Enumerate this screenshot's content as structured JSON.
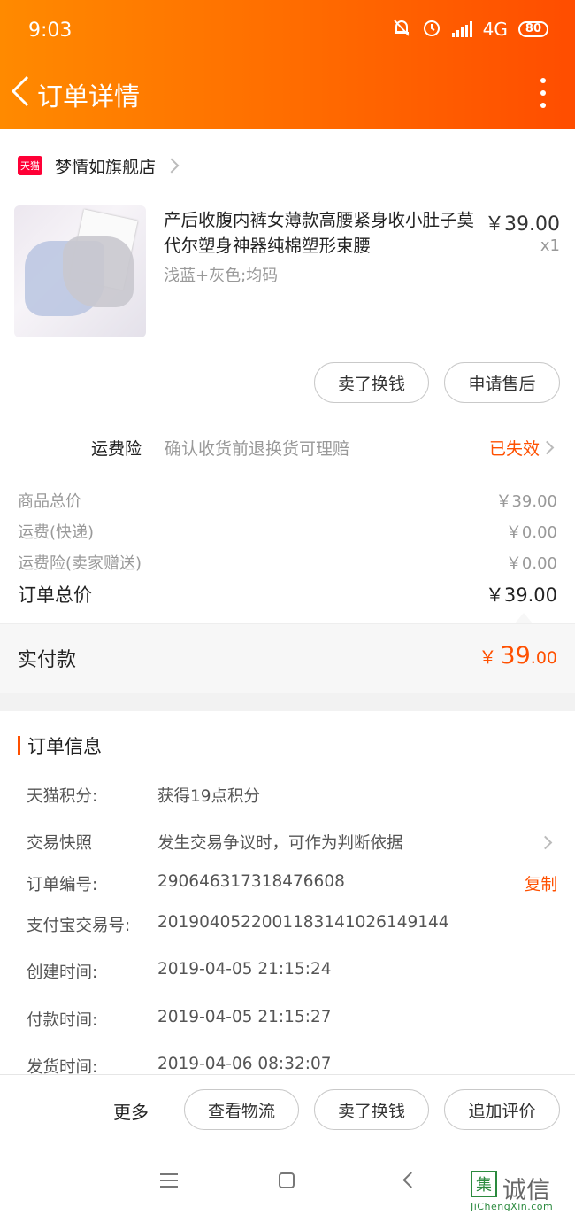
{
  "status_bar": {
    "time": "9:03",
    "network": "4G",
    "battery": "80"
  },
  "header": {
    "title": "订单详情"
  },
  "store": {
    "badge": "天猫",
    "name": "梦情如旗舰店"
  },
  "product": {
    "title": "产后收腹内裤女薄款高腰紧身收小肚子莫代尔塑身神器纯棉塑形束腰",
    "price": "￥39.00",
    "quantity": "x1",
    "spec": "浅蓝+灰色;均码"
  },
  "item_actions": {
    "sell": "卖了换钱",
    "after_sale": "申请售后"
  },
  "insurance": {
    "label": "运费险",
    "desc": "确认收货前退换货可理赔",
    "status": "已失效"
  },
  "fees": [
    {
      "label": "商品总价",
      "value": "￥39.00"
    },
    {
      "label": "运费(快递)",
      "value": "￥0.00"
    },
    {
      "label": "运费险(卖家赠送)",
      "value": "￥0.00"
    }
  ],
  "order_total": {
    "label": "订单总价",
    "value": "￥39.00"
  },
  "paid": {
    "label": "实付款",
    "currency": "￥",
    "integer": "39",
    "decimal": ".00"
  },
  "order_info": {
    "title": "订单信息",
    "rows": [
      {
        "key": "天猫积分:",
        "value": "获得19点积分"
      },
      {
        "key": "交易快照",
        "value": "发生交易争议时，可作为判断依据"
      },
      {
        "key": "订单编号:",
        "value": "290646317318476608",
        "action": "复制"
      },
      {
        "key": "支付宝交易号:",
        "value": "2019040522001183141026149144"
      },
      {
        "key": "创建时间:",
        "value": "2019-04-05 21:15:24"
      },
      {
        "key": "付款时间:",
        "value": "2019-04-05 21:15:27"
      },
      {
        "key": "发货时间:",
        "value": "2019-04-06 08:32:07"
      }
    ]
  },
  "bottom_actions": {
    "more": "更多",
    "logistics": "查看物流",
    "sell": "卖了换钱",
    "review": "追加评价"
  },
  "watermark": {
    "logo": "集",
    "text": "诚信",
    "url": "JiChengXin.com"
  },
  "colors": {
    "brand_orange": "#ff5000",
    "header_start": "#ff8a00",
    "header_end": "#ff4d00",
    "tmall_red": "#ff0036"
  },
  "icons": [
    "mute-bell-icon",
    "alarm-icon",
    "signal-icon",
    "battery-icon",
    "back-arrow-icon",
    "more-vertical-icon",
    "chevron-right-icon",
    "nav-menu-icon",
    "nav-home-icon",
    "nav-back-icon"
  ]
}
